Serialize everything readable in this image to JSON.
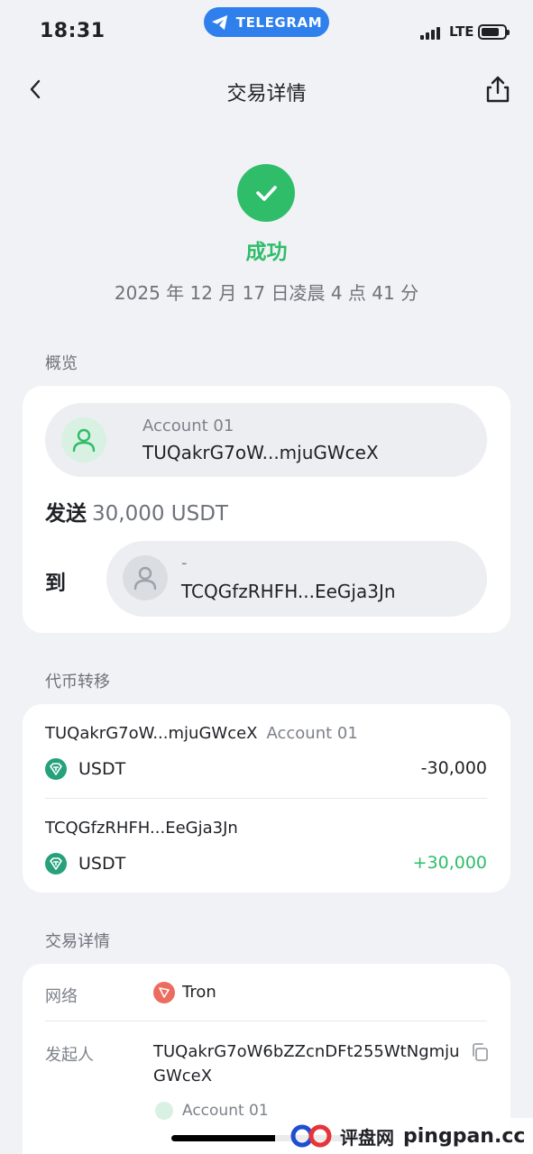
{
  "status_bar": {
    "time": "18:31",
    "app_pill": "TELEGRAM",
    "network": "LTE"
  },
  "nav": {
    "title": "交易详情"
  },
  "result": {
    "status": "成功",
    "datetime": "2025 年 12 月 17 日凌晨 4 点 41 分",
    "color": "#2fbd69"
  },
  "overview": {
    "section_label": "概览",
    "from_name": "Account 01",
    "from_address": "TUQakrG7oW...mjuGWceX",
    "send_label": "发送",
    "send_amount": "30,000 USDT",
    "to_label": "到",
    "to_name": "-",
    "to_address": "TCQGfzRHFH...EeGja3Jn"
  },
  "token_transfer": {
    "section_label": "代币转移",
    "rows": [
      {
        "address": "TUQakrG7oW...mjuGWceX",
        "account": "Account 01",
        "symbol": "USDT",
        "amount": "-30,000"
      },
      {
        "address": "TCQGfzRHFH...EeGja3Jn",
        "account": "",
        "symbol": "USDT",
        "amount": "+30,000"
      }
    ]
  },
  "details": {
    "section_label": "交易详情",
    "network_label": "网络",
    "network_value": "Tron",
    "initiator_label": "发起人",
    "initiator_address_line1": "TUQakrG7oW6bZZcnDFt255WtNgmju",
    "initiator_address_line2": "GWceX",
    "initiator_account": "Account 01"
  },
  "watermark": {
    "cn": "评盘网",
    "en": "pingpan.cc"
  },
  "icons": {
    "back": "chevron-left-icon",
    "share": "share-icon",
    "success": "check-icon",
    "user": "user-icon",
    "token": "usdt-icon",
    "network": "tron-icon",
    "copy": "copy-icon"
  }
}
